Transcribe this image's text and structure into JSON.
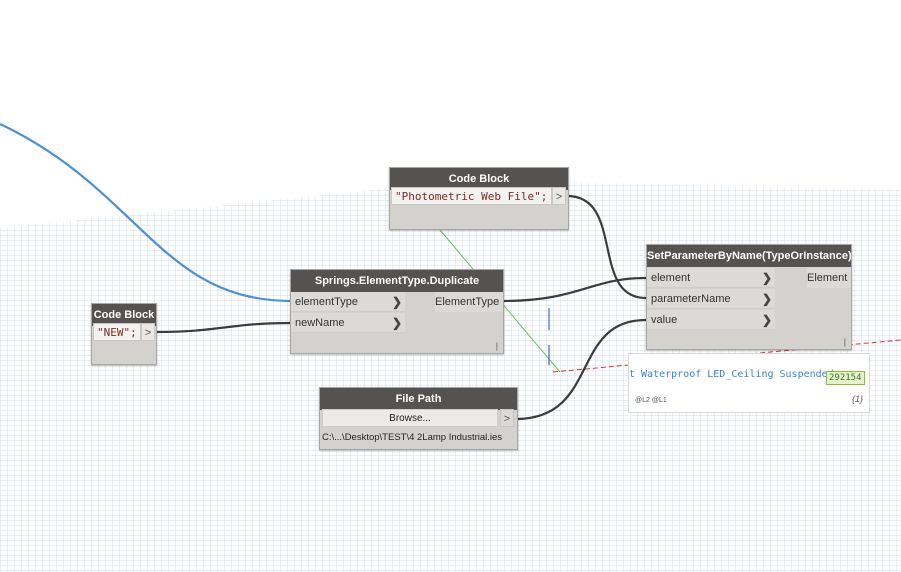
{
  "nodes": {
    "code_block_photometric": {
      "title": "Code Block",
      "code": "\"Photometric Web File\";",
      "out_symbol": ">"
    },
    "code_block_new": {
      "title": "Code Block",
      "code": "\"NEW\";",
      "out_symbol": ">"
    },
    "duplicate": {
      "title": "Springs.ElementType.Duplicate",
      "inputs": [
        "elementType",
        "newName"
      ],
      "output": "ElementType"
    },
    "set_parameter": {
      "title": "SetParameterByName(TypeOrInstance)",
      "inputs": [
        "element",
        "parameterName",
        "value"
      ],
      "output": "Element"
    },
    "file_path": {
      "title": "File Path",
      "button_label": "Browse...",
      "out_symbol": ">",
      "path": "C:\\...\\Desktop\\TEST\\4 2Lamp Industrial.ies"
    }
  },
  "preview": {
    "text": "t Waterproof LED_Ceiling Suspended",
    "element_id": "292154",
    "levels": "@L2 @L1",
    "count": "{1}"
  },
  "colors": {
    "wire": "#3c3c3c",
    "selected_wire": "#4a90d9",
    "node_header": "#555351",
    "node_body": "#d4d2ce",
    "grid": "#b9cde0"
  }
}
